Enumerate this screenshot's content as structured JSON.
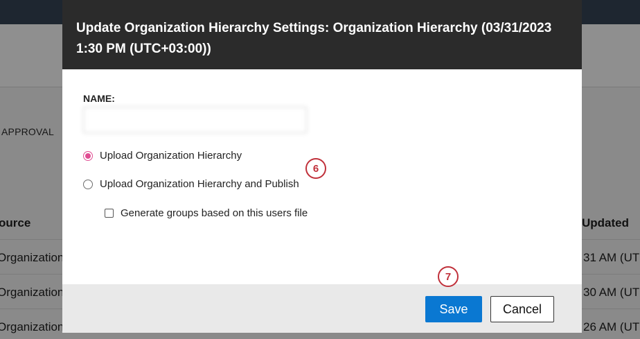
{
  "background": {
    "approval_label": "APPROVAL",
    "columns": {
      "source": "ource",
      "updated": "Updated"
    },
    "rows": [
      {
        "source": "Organization",
        "updated": "31 AM (UTC"
      },
      {
        "source": "Organization",
        "updated": "30 AM (UTC"
      },
      {
        "source": "Organization",
        "updated": "26 AM (UTC"
      }
    ]
  },
  "modal": {
    "title": "Update Organization Hierarchy Settings: Organization Hierarchy (03/31/2023 1:30 PM (UTC+03:00))",
    "name_label": "NAME:",
    "name_value": "",
    "options": {
      "upload": "Upload Organization Hierarchy",
      "upload_publish": "Upload Organization Hierarchy and Publish",
      "generate_groups": "Generate groups based on this users file"
    },
    "badges": {
      "step6": "6",
      "step7": "7"
    },
    "buttons": {
      "save": "Save",
      "cancel": "Cancel"
    }
  },
  "colors": {
    "accent": "#0a78d2",
    "radio_selected": "#e04d92",
    "badge": "#c0303a"
  }
}
